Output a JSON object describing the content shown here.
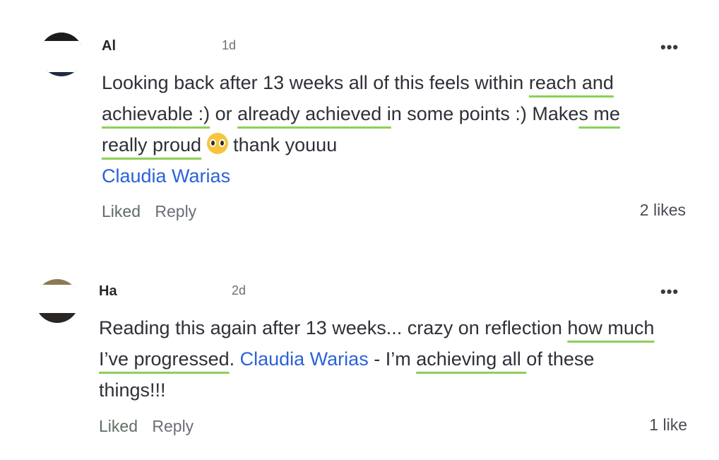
{
  "comments": [
    {
      "author": "Al",
      "time": "1d",
      "more": "•••",
      "text_parts": [
        "Looking back after 13 weeks all of this feels within ",
        "reach and achievable :)",
        " or ",
        "already achieved i",
        "n some points :) Make",
        "s me really proud",
        " thank youuu "
      ],
      "mention": "Claudia Warias",
      "liked_label": "Liked",
      "reply_label": "Reply",
      "likes": "2 likes",
      "avatar_colors": {
        "top": "#1c1c1c",
        "bottom": "#1f2a44"
      }
    },
    {
      "author": "Ha",
      "time": "2d",
      "more": "•••",
      "text_parts": [
        "Reading this again after 13 weeks... crazy on reflection ",
        "how much I’ve progressed",
        ". ",
        " - I’m ",
        "achieving all ",
        "of these things!!!"
      ],
      "mention": "Claudia Warias",
      "liked_label": "Liked",
      "reply_label": "Reply",
      "likes": "1 like",
      "avatar_colors": {
        "top": "#8a7a55",
        "bottom": "#2a2623"
      }
    }
  ],
  "colors": {
    "mention": "#2b62d9",
    "highlight": "#8ccf5a",
    "liked": "#5f6d63"
  },
  "icons": {
    "more": "more-options-icon",
    "emoji": "pleading-face-emoji"
  }
}
